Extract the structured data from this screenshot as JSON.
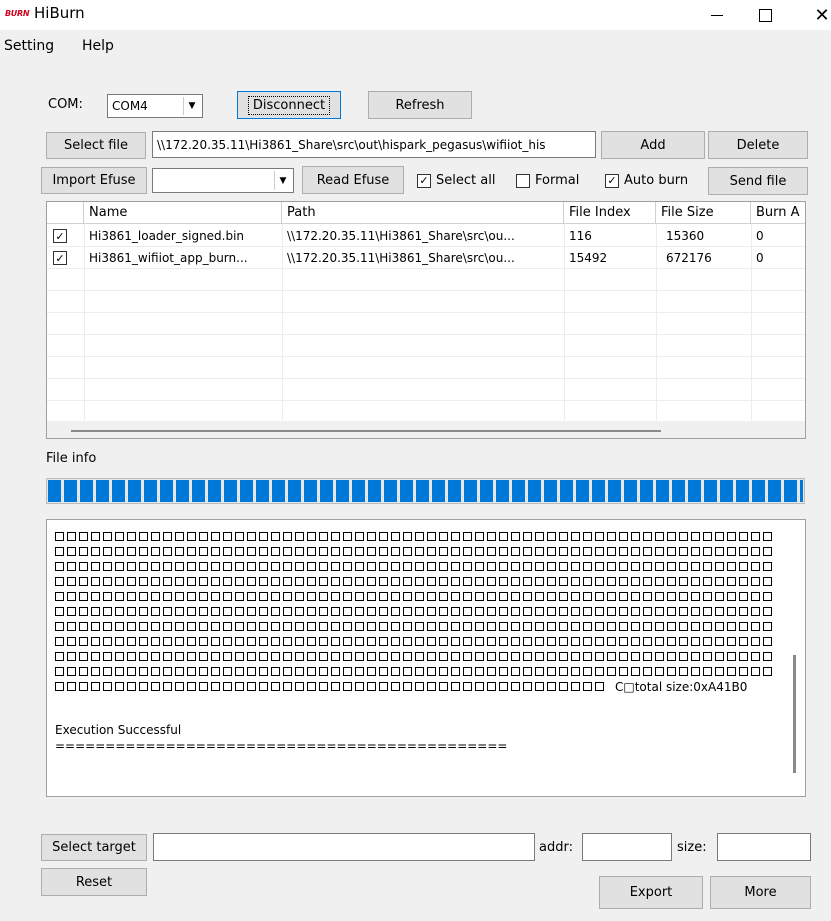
{
  "window": {
    "logo_text": "BURN",
    "title": "HiBurn",
    "close_symbol": "✕"
  },
  "menu": [
    "Setting",
    "Help"
  ],
  "com": {
    "label": "COM:",
    "selected": "COM4",
    "disconnect_label": "Disconnect",
    "refresh_label": "Refresh"
  },
  "file_row": {
    "select_file_label": "Select file",
    "path_value": "\\\\172.20.35.11\\Hi3861_Share\\src\\out\\hispark_pegasus\\wifiiot_his",
    "add_label": "Add",
    "delete_label": "Delete"
  },
  "efuse_row": {
    "import_efuse_label": "Import Efuse",
    "efuse_selected": "",
    "read_efuse_label": "Read Efuse",
    "select_all_label": "Select all",
    "select_all_checked": true,
    "formal_label": "Formal",
    "formal_checked": false,
    "auto_burn_label": "Auto burn",
    "auto_burn_checked": true,
    "send_file_label": "Send file"
  },
  "table": {
    "columns": [
      "",
      "Name",
      "Path",
      "File Index",
      "File Size",
      "Burn A"
    ],
    "rows": [
      {
        "checked": true,
        "name": "Hi3861_loader_signed.bin",
        "path": "\\\\172.20.35.11\\Hi3861_Share\\src\\ou...",
        "file_index": "116",
        "file_size": "15360",
        "burn": "0"
      },
      {
        "checked": true,
        "name": "Hi3861_wifiiot_app_burn...",
        "path": "\\\\172.20.35.11\\Hi3861_Share\\src\\ou...",
        "file_index": "15492",
        "file_size": "672176",
        "burn": "0"
      }
    ]
  },
  "file_info_label": "File info",
  "progress": {
    "value": 1.0
  },
  "log": {
    "total_size_text": "C□total size:0xA41B0",
    "success_text": "Execution Successful",
    "separator": "============================================="
  },
  "bottom": {
    "select_target_label": "Select target",
    "target_value": "",
    "addr_label": "addr:",
    "addr_value": "",
    "size_label": "size:",
    "size_value": "",
    "reset_label": "Reset",
    "export_label": "Export",
    "more_label": "More"
  },
  "colors": {
    "progress_blue": "#0078d7",
    "logo_red": "#d0021b",
    "window_bg": "#f0f0f0"
  },
  "icons": {
    "minimize": "minimize-icon",
    "maximize": "maximize-icon",
    "close": "close-icon",
    "combo": "chevron-down-icon",
    "check": "checkmark-icon"
  }
}
